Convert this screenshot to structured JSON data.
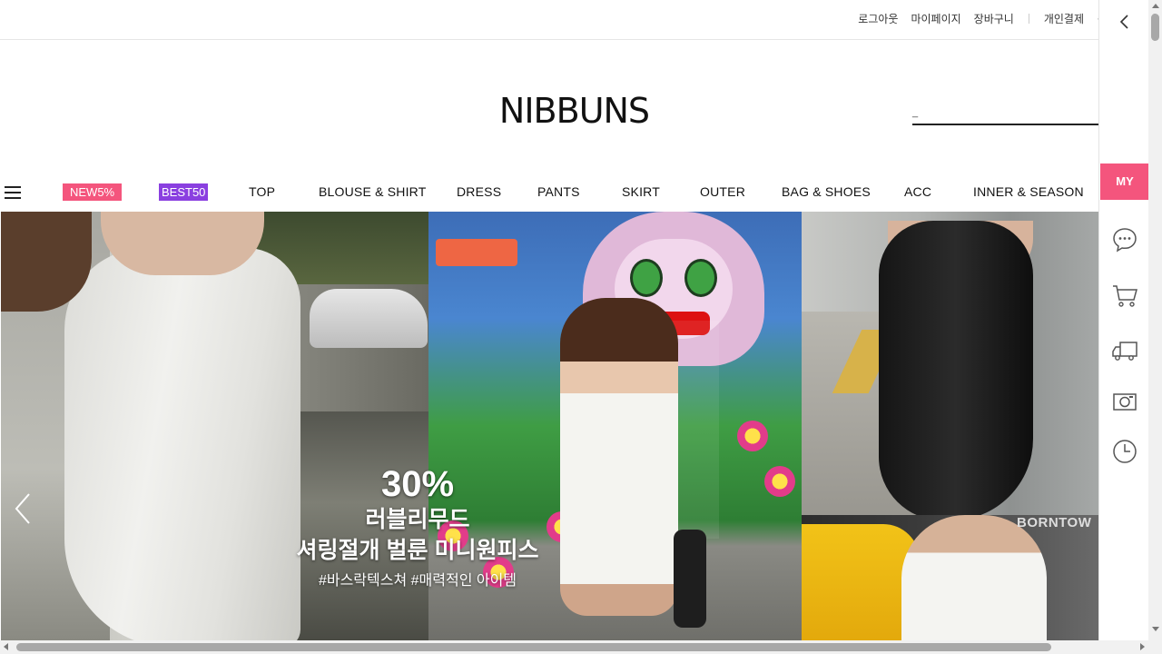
{
  "topbar": {
    "links": [
      "로그아웃",
      "마이페이지",
      "장바구니"
    ],
    "payment": "개인결제",
    "more": "·"
  },
  "brand": {
    "logo": "NIBBUNS"
  },
  "search": {
    "value": "_",
    "placeholder": ""
  },
  "nav": {
    "menu_icon": "hamburger-icon",
    "badges": [
      {
        "label": "NEW5%",
        "color": "#f4557d"
      },
      {
        "label": "BEST50",
        "color": "#8a3fe0"
      }
    ],
    "items": [
      "TOP",
      "BLOUSE & SHIRT",
      "DRESS",
      "PANTS",
      "SKIRT",
      "OUTER",
      "BAG & SHOES",
      "ACC",
      "INNER & SEASON"
    ]
  },
  "banner": {
    "discount": "30%",
    "line1": "러블리무드",
    "line2": "셔링절개 벌룬 미니원피스",
    "tags": "#바스락텍스쳐 #매력적인 아이템",
    "side_sign": "BORNTOW",
    "prev_icon": "chevron-left-icon"
  },
  "quickbar": {
    "back_icon": "chevron-left-icon",
    "my_label": "MY",
    "my_color": "#f4557d",
    "icons": [
      "chat-icon",
      "cart-icon",
      "truck-icon",
      "camera-icon",
      "clock-icon"
    ]
  }
}
